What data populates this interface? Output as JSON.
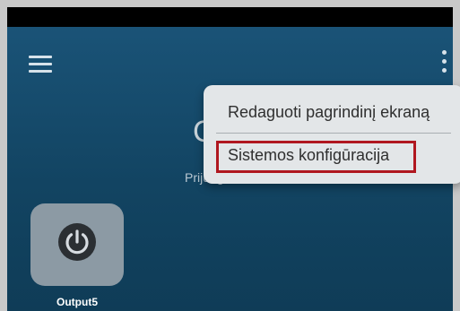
{
  "app": {
    "title_partial": "G",
    "status_text": "Prijungtas  m",
    "menu": {
      "items": [
        {
          "label": "Redaguoti pagrindinį ekraną"
        },
        {
          "label": "Sistemos konfigūracija",
          "highlighted": true
        }
      ]
    },
    "tiles": [
      {
        "label": "Output5",
        "icon": "power-icon"
      }
    ]
  },
  "colors": {
    "screen_bg": "#124462",
    "tile_bg": "#8c9aa4",
    "menu_bg": "#e3e6e8",
    "highlight": "#b0171f"
  },
  "icons": {
    "menu": "hamburger-menu-icon",
    "more": "kebab-menu-icon"
  }
}
